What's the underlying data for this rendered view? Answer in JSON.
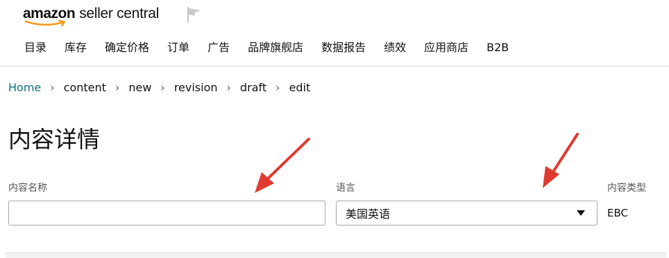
{
  "header": {
    "brand_primary": "amazon",
    "brand_secondary": "seller central",
    "icons": [
      "amazon-smile-icon",
      "flag-icon"
    ]
  },
  "nav": {
    "items": [
      "目录",
      "库存",
      "确定价格",
      "订单",
      "广告",
      "品牌旗舰店",
      "数据报告",
      "绩效",
      "应用商店",
      "B2B"
    ]
  },
  "breadcrumb": {
    "items": [
      "Home",
      "content",
      "new",
      "revision",
      "draft",
      "edit"
    ]
  },
  "page": {
    "title": "内容详情"
  },
  "form": {
    "name_label": "内容名称",
    "name_value": "",
    "language_label": "语言",
    "language_value": "美国英语",
    "type_label": "内容类型",
    "type_value": "EBC"
  },
  "annotations": {
    "arrow_color": "#e03a2f",
    "arrow_count": 2
  },
  "colors": {
    "link": "#0f6f7d",
    "border": "#a6a6a6",
    "label": "#555555"
  }
}
